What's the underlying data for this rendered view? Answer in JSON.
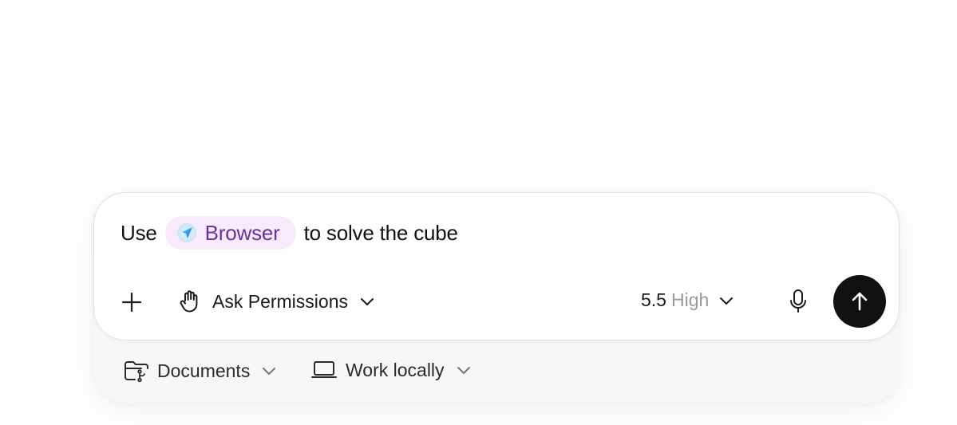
{
  "composer": {
    "prompt_before": "Use",
    "mention_label": "Browser",
    "prompt_after": "to solve the cube"
  },
  "toolbar": {
    "add_icon": "plus-icon",
    "permissions_icon": "hand-icon",
    "permissions_label": "Ask Permissions",
    "model_version": "5.5",
    "model_effort": "High",
    "mic_icon": "microphone-icon",
    "send_icon": "arrow-up-icon"
  },
  "footer": {
    "folder_label": "Documents",
    "environment_label": "Work locally"
  },
  "colors": {
    "mention_bg": "#f7ebfb",
    "mention_text": "#6a2fa6",
    "send_bg": "#111111"
  }
}
